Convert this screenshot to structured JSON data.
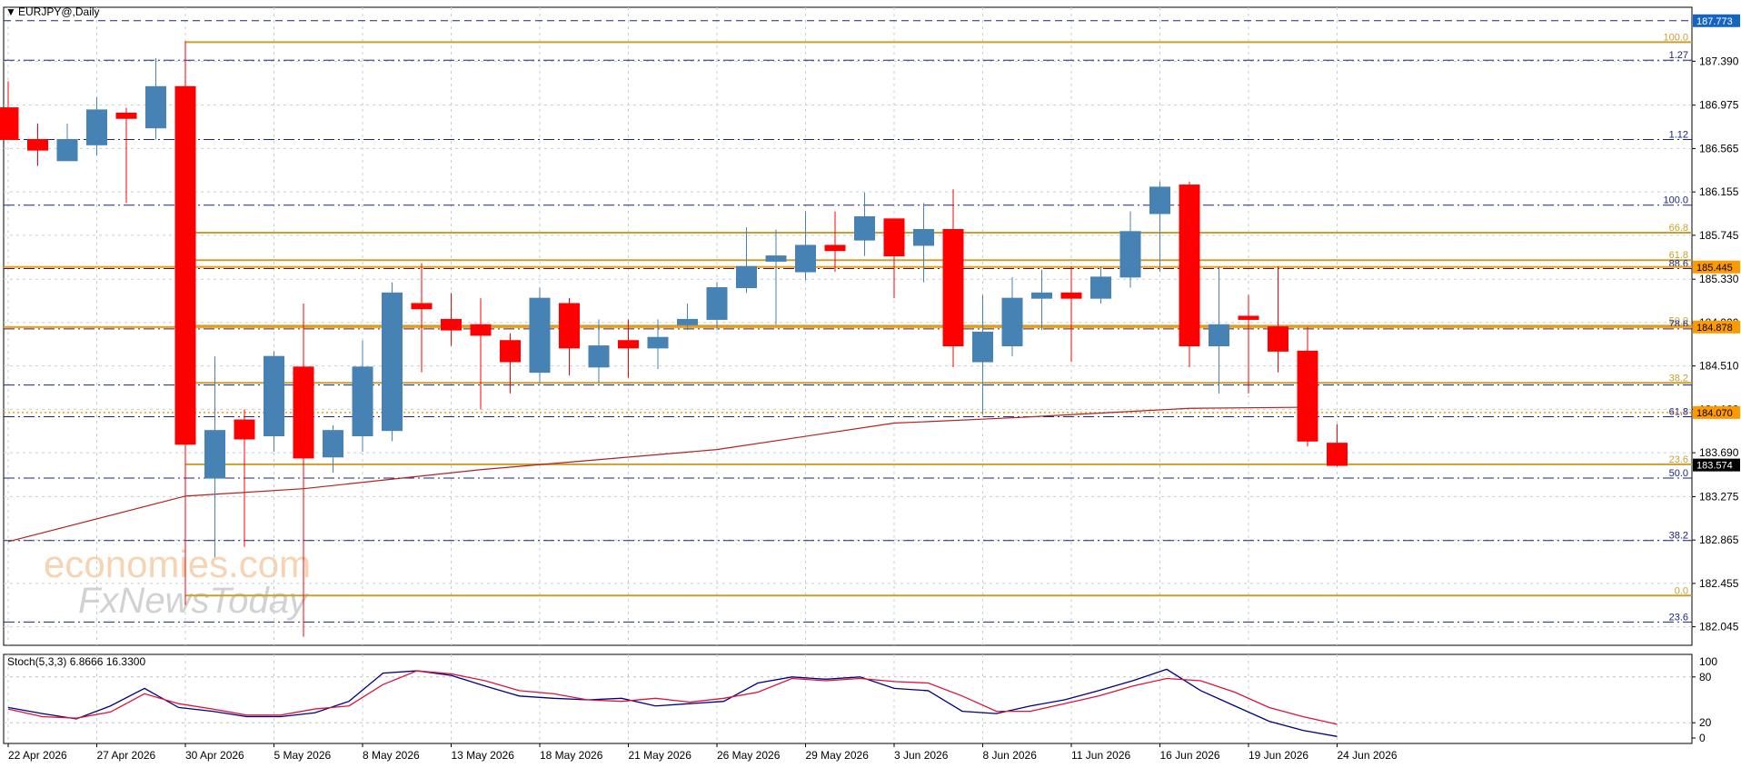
{
  "symbol_label": "EURJPY@,Daily",
  "watermark": {
    "line1": "economies.com",
    "line2": "FxNewsToday"
  },
  "colors": {
    "bull": "#4682b4",
    "bear": "#ff0000",
    "ma": "#b22222",
    "fib_gold": "#c8a032",
    "fib_navy": "#1a237e",
    "hline_orange": "#ff9900",
    "stoch_main": "#000080",
    "stoch_signal": "#dc143c",
    "grid": "#c0d0d8"
  },
  "chart_data": [
    {
      "type": "candlestick",
      "title": "EURJPY@,Daily",
      "ylim": [
        181.87,
        187.9
      ],
      "y_ticks": [
        "187.390",
        "186.975",
        "186.565",
        "186.155",
        "185.745",
        "185.330",
        "184.920",
        "184.510",
        "184.100",
        "183.690",
        "183.275",
        "182.865",
        "182.455",
        "182.045"
      ],
      "x_ticks": [
        "22 Apr 2026",
        "27 Apr 2026",
        "30 Apr 2026",
        "5 May 2026",
        "8 May 2026",
        "13 May 2026",
        "18 May 2026",
        "21 May 2026",
        "26 May 2026",
        "29 May 2026",
        "3 Jun 2026",
        "8 Jun 2026",
        "11 Jun 2026",
        "16 Jun 2026",
        "19 Jun 2026",
        "24 Jun 2026"
      ],
      "candles": [
        {
          "o": 186.95,
          "h": 187.2,
          "l": 186.65,
          "c": 186.65
        },
        {
          "o": 186.65,
          "h": 186.8,
          "l": 186.4,
          "c": 186.55
        },
        {
          "o": 186.45,
          "h": 186.8,
          "l": 186.45,
          "c": 186.65
        },
        {
          "o": 186.6,
          "h": 187.05,
          "l": 186.5,
          "c": 186.93
        },
        {
          "o": 186.9,
          "h": 186.95,
          "l": 186.05,
          "c": 186.85
        },
        {
          "o": 186.76,
          "h": 187.42,
          "l": 186.65,
          "c": 187.15
        },
        {
          "o": 187.15,
          "h": 187.58,
          "l": 182.25,
          "c": 183.77
        },
        {
          "o": 183.45,
          "h": 184.6,
          "l": 182.7,
          "c": 183.9
        },
        {
          "o": 184.0,
          "h": 184.1,
          "l": 182.8,
          "c": 183.82
        },
        {
          "o": 183.85,
          "h": 184.65,
          "l": 183.7,
          "c": 184.6
        },
        {
          "o": 184.5,
          "h": 185.1,
          "l": 181.95,
          "c": 183.64
        },
        {
          "o": 183.65,
          "h": 183.95,
          "l": 183.5,
          "c": 183.9
        },
        {
          "o": 183.85,
          "h": 184.75,
          "l": 183.7,
          "c": 184.5
        },
        {
          "o": 183.9,
          "h": 185.3,
          "l": 183.8,
          "c": 185.2
        },
        {
          "o": 185.1,
          "h": 185.48,
          "l": 184.45,
          "c": 185.05
        },
        {
          "o": 184.95,
          "h": 185.2,
          "l": 184.7,
          "c": 184.85
        },
        {
          "o": 184.9,
          "h": 185.15,
          "l": 184.1,
          "c": 184.8
        },
        {
          "o": 184.75,
          "h": 184.82,
          "l": 184.25,
          "c": 184.55
        },
        {
          "o": 184.45,
          "h": 185.25,
          "l": 184.35,
          "c": 185.15
        },
        {
          "o": 185.1,
          "h": 185.15,
          "l": 184.42,
          "c": 184.68
        },
        {
          "o": 184.5,
          "h": 184.95,
          "l": 184.35,
          "c": 184.7
        },
        {
          "o": 184.75,
          "h": 184.95,
          "l": 184.4,
          "c": 184.68
        },
        {
          "o": 184.68,
          "h": 184.95,
          "l": 184.48,
          "c": 184.78
        },
        {
          "o": 184.9,
          "h": 185.1,
          "l": 184.85,
          "c": 184.95
        },
        {
          "o": 184.95,
          "h": 185.3,
          "l": 184.85,
          "c": 185.25
        },
        {
          "o": 185.25,
          "h": 185.82,
          "l": 185.2,
          "c": 185.45
        },
        {
          "o": 185.5,
          "h": 185.8,
          "l": 184.9,
          "c": 185.55
        },
        {
          "o": 185.4,
          "h": 185.97,
          "l": 185.32,
          "c": 185.65
        },
        {
          "o": 185.65,
          "h": 185.97,
          "l": 185.4,
          "c": 185.6
        },
        {
          "o": 185.7,
          "h": 186.15,
          "l": 185.55,
          "c": 185.92
        },
        {
          "o": 185.9,
          "h": 185.9,
          "l": 185.15,
          "c": 185.55
        },
        {
          "o": 185.65,
          "h": 186.05,
          "l": 185.3,
          "c": 185.8
        },
        {
          "o": 185.8,
          "h": 186.18,
          "l": 184.5,
          "c": 184.7
        },
        {
          "o": 184.55,
          "h": 185.18,
          "l": 184.05,
          "c": 184.83
        },
        {
          "o": 184.7,
          "h": 185.35,
          "l": 184.6,
          "c": 185.15
        },
        {
          "o": 185.15,
          "h": 185.42,
          "l": 184.85,
          "c": 185.2
        },
        {
          "o": 185.2,
          "h": 185.45,
          "l": 184.55,
          "c": 185.15
        },
        {
          "o": 185.15,
          "h": 185.45,
          "l": 185.1,
          "c": 185.35
        },
        {
          "o": 185.35,
          "h": 185.97,
          "l": 185.25,
          "c": 185.78
        },
        {
          "o": 185.95,
          "h": 186.25,
          "l": 185.4,
          "c": 186.2
        },
        {
          "o": 186.22,
          "h": 186.25,
          "l": 184.5,
          "c": 184.7
        },
        {
          "o": 184.7,
          "h": 185.45,
          "l": 184.25,
          "c": 184.9
        },
        {
          "o": 184.98,
          "h": 185.18,
          "l": 184.25,
          "c": 184.95
        },
        {
          "o": 184.88,
          "h": 185.45,
          "l": 184.45,
          "c": 184.65
        },
        {
          "o": 184.65,
          "h": 184.88,
          "l": 183.75,
          "c": 183.8
        },
        {
          "o": 183.78,
          "h": 183.96,
          "l": 183.56,
          "c": 183.57
        }
      ],
      "moving_average": {
        "color": "#b22222",
        "points": [
          [
            0,
            182.85
          ],
          [
            6,
            183.28
          ],
          [
            10,
            183.35
          ],
          [
            16,
            183.53
          ],
          [
            24,
            183.72
          ],
          [
            30,
            183.97
          ],
          [
            34,
            184.02
          ],
          [
            40,
            184.11
          ],
          [
            44,
            184.12
          ]
        ]
      },
      "fib_lines": [
        {
          "price": 187.57,
          "style": "solid",
          "color": "#c8a032",
          "label": "100.0",
          "x_from": 6
        },
        {
          "price": 187.4,
          "style": "dashdot",
          "color": "#1a237e",
          "label": "1.27"
        },
        {
          "price": 186.65,
          "style": "dashdot",
          "color": "#1a237e",
          "label": "1.12"
        },
        {
          "price": 186.03,
          "style": "dashdot",
          "color": "#1a237e",
          "label": "100.0"
        },
        {
          "price": 185.77,
          "style": "solid",
          "color": "#c8a032",
          "label": "66.8",
          "x_from": 6
        },
        {
          "price": 185.51,
          "style": "solid",
          "color": "#c8a032",
          "label": "61.8",
          "x_from": 6
        },
        {
          "price": 185.43,
          "style": "dashdot",
          "color": "#1a237e",
          "label": "88.6"
        },
        {
          "price": 184.89,
          "style": "solid",
          "color": "#c8a032",
          "label": "50.0",
          "x_from": 6
        },
        {
          "price": 184.86,
          "style": "dashdot",
          "color": "#1a237e",
          "label": "78.6"
        },
        {
          "price": 184.35,
          "style": "solid",
          "color": "#c8a032",
          "label": "38.2",
          "x_from": 6
        },
        {
          "price": 184.33,
          "style": "dashdot",
          "color": "#1a237e",
          "label": ""
        },
        {
          "price": 184.03,
          "style": "dashdot",
          "color": "#1a237e",
          "label": "61.8"
        },
        {
          "price": 183.58,
          "style": "solid",
          "color": "#c8a032",
          "label": "23.6",
          "x_from": 6
        },
        {
          "price": 183.45,
          "style": "dashdot",
          "color": "#1a237e",
          "label": "50.0"
        },
        {
          "price": 182.86,
          "style": "dashdot",
          "color": "#1a237e",
          "label": "38.2"
        },
        {
          "price": 182.34,
          "style": "solid",
          "color": "#c8a032",
          "label": "0.0",
          "x_from": 6
        },
        {
          "price": 182.09,
          "style": "dashdot",
          "color": "#1a237e",
          "label": "23.6"
        },
        {
          "price": 187.773,
          "style": "dashed",
          "color": "#1a237e",
          "label": ""
        }
      ],
      "horizontal_levels": [
        {
          "price": 185.445,
          "color": "#ff9900",
          "badge": "185.445"
        },
        {
          "price": 184.878,
          "color": "#ff9900",
          "badge": "184.878"
        },
        {
          "price": 184.07,
          "color": "#ff9900",
          "badge": "184.070",
          "dotted": true
        }
      ],
      "price_badges": [
        {
          "price": 187.773,
          "text": "187.773",
          "bg": "#1565c0"
        },
        {
          "price": 183.574,
          "text": "183.574",
          "bg": "#000000"
        }
      ],
      "grid": true
    },
    {
      "type": "line",
      "title": "Stoch(5,3,3) 6.8666 16.3300",
      "ylim": [
        0,
        100
      ],
      "y_ticks": [
        80,
        20,
        0
      ],
      "series": [
        {
          "values": [
            40,
            32,
            25,
            42,
            65,
            40,
            35,
            28,
            28,
            33,
            48,
            85,
            88,
            82,
            68,
            55,
            52,
            50,
            52,
            42,
            45,
            48,
            72,
            80,
            77,
            80,
            65,
            62,
            35,
            32,
            42,
            50,
            62,
            75,
            90,
            62,
            42,
            22,
            10,
            2
          ]
        },
        {
          "values": [
            38,
            28,
            26,
            34,
            58,
            45,
            38,
            30,
            30,
            38,
            42,
            70,
            88,
            84,
            75,
            62,
            58,
            50,
            48,
            52,
            47,
            52,
            60,
            78,
            75,
            78,
            74,
            72,
            55,
            35,
            35,
            45,
            55,
            68,
            78,
            75,
            60,
            40,
            28,
            18
          ]
        }
      ]
    }
  ]
}
